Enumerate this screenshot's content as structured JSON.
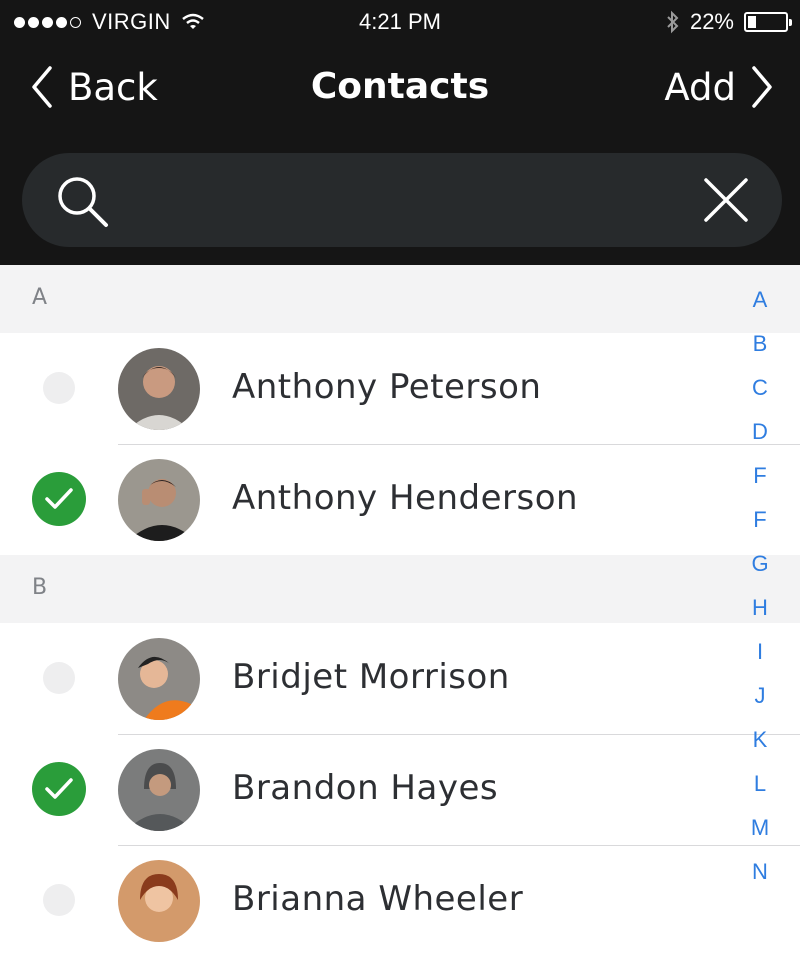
{
  "status": {
    "carrier": "VIRGIN",
    "time": "4:21 PM",
    "battery": "22%",
    "battery_level": 0.22
  },
  "nav": {
    "back_label": "Back",
    "title": "Contacts",
    "add_label": "Add"
  },
  "search": {
    "value": ""
  },
  "sections": [
    {
      "letter": "A",
      "contacts": [
        {
          "name": "Anthony Peterson",
          "selected": false
        },
        {
          "name": "Anthony Henderson",
          "selected": true
        }
      ]
    },
    {
      "letter": "B",
      "contacts": [
        {
          "name": "Bridjet Morrison",
          "selected": false
        },
        {
          "name": "Brandon Hayes",
          "selected": true
        },
        {
          "name": "Brianna Wheeler",
          "selected": false
        }
      ]
    }
  ],
  "index_letters": [
    "A",
    "B",
    "C",
    "D",
    "F",
    "F",
    "G",
    "H",
    "I",
    "J",
    "K",
    "L",
    "M",
    "N"
  ],
  "colors": {
    "accent": "#2f7de0",
    "check": "#2a9d3a",
    "header_bg": "#151515"
  },
  "icons": {
    "back": "chevron-left-icon",
    "add": "chevron-right-icon",
    "search": "search-icon",
    "clear": "close-icon"
  }
}
